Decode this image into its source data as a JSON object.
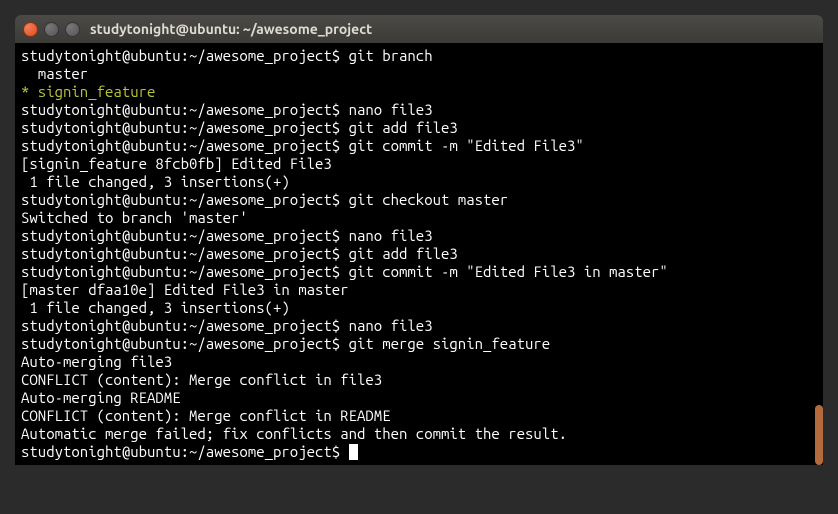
{
  "window": {
    "title": "studytonight@ubuntu: ~/awesome_project"
  },
  "terminal": {
    "prompt": "studytonight@ubuntu:~/awesome_project$",
    "lines": {
      "cmd_branch": "git branch",
      "branch_master": "  master",
      "branch_signin": "* signin_feature",
      "cmd_nano1": "nano file3",
      "cmd_add1": "git add file3",
      "cmd_commit1": "git commit -m \"Edited File3\"",
      "commit1_out1": "[signin_feature 8fcb0fb] Edited File3",
      "commit1_out2": " 1 file changed, 3 insertions(+)",
      "cmd_checkout": "git checkout master",
      "checkout_out": "Switched to branch 'master'",
      "cmd_nano2": "nano file3",
      "cmd_add2": "git add file3",
      "cmd_commit2": "git commit -m \"Edited File3 in master\"",
      "commit2_out1": "[master dfaa10e] Edited File3 in master",
      "commit2_out2": " 1 file changed, 3 insertions(+)",
      "cmd_nano3": "nano file3",
      "cmd_merge": "git merge signin_feature",
      "merge_out1": "Auto-merging file3",
      "merge_out2": "CONFLICT (content): Merge conflict in file3",
      "merge_out3": "Auto-merging README",
      "merge_out4": "CONFLICT (content): Merge conflict in README",
      "merge_out5": "Automatic merge failed; fix conflicts and then commit the result."
    }
  }
}
